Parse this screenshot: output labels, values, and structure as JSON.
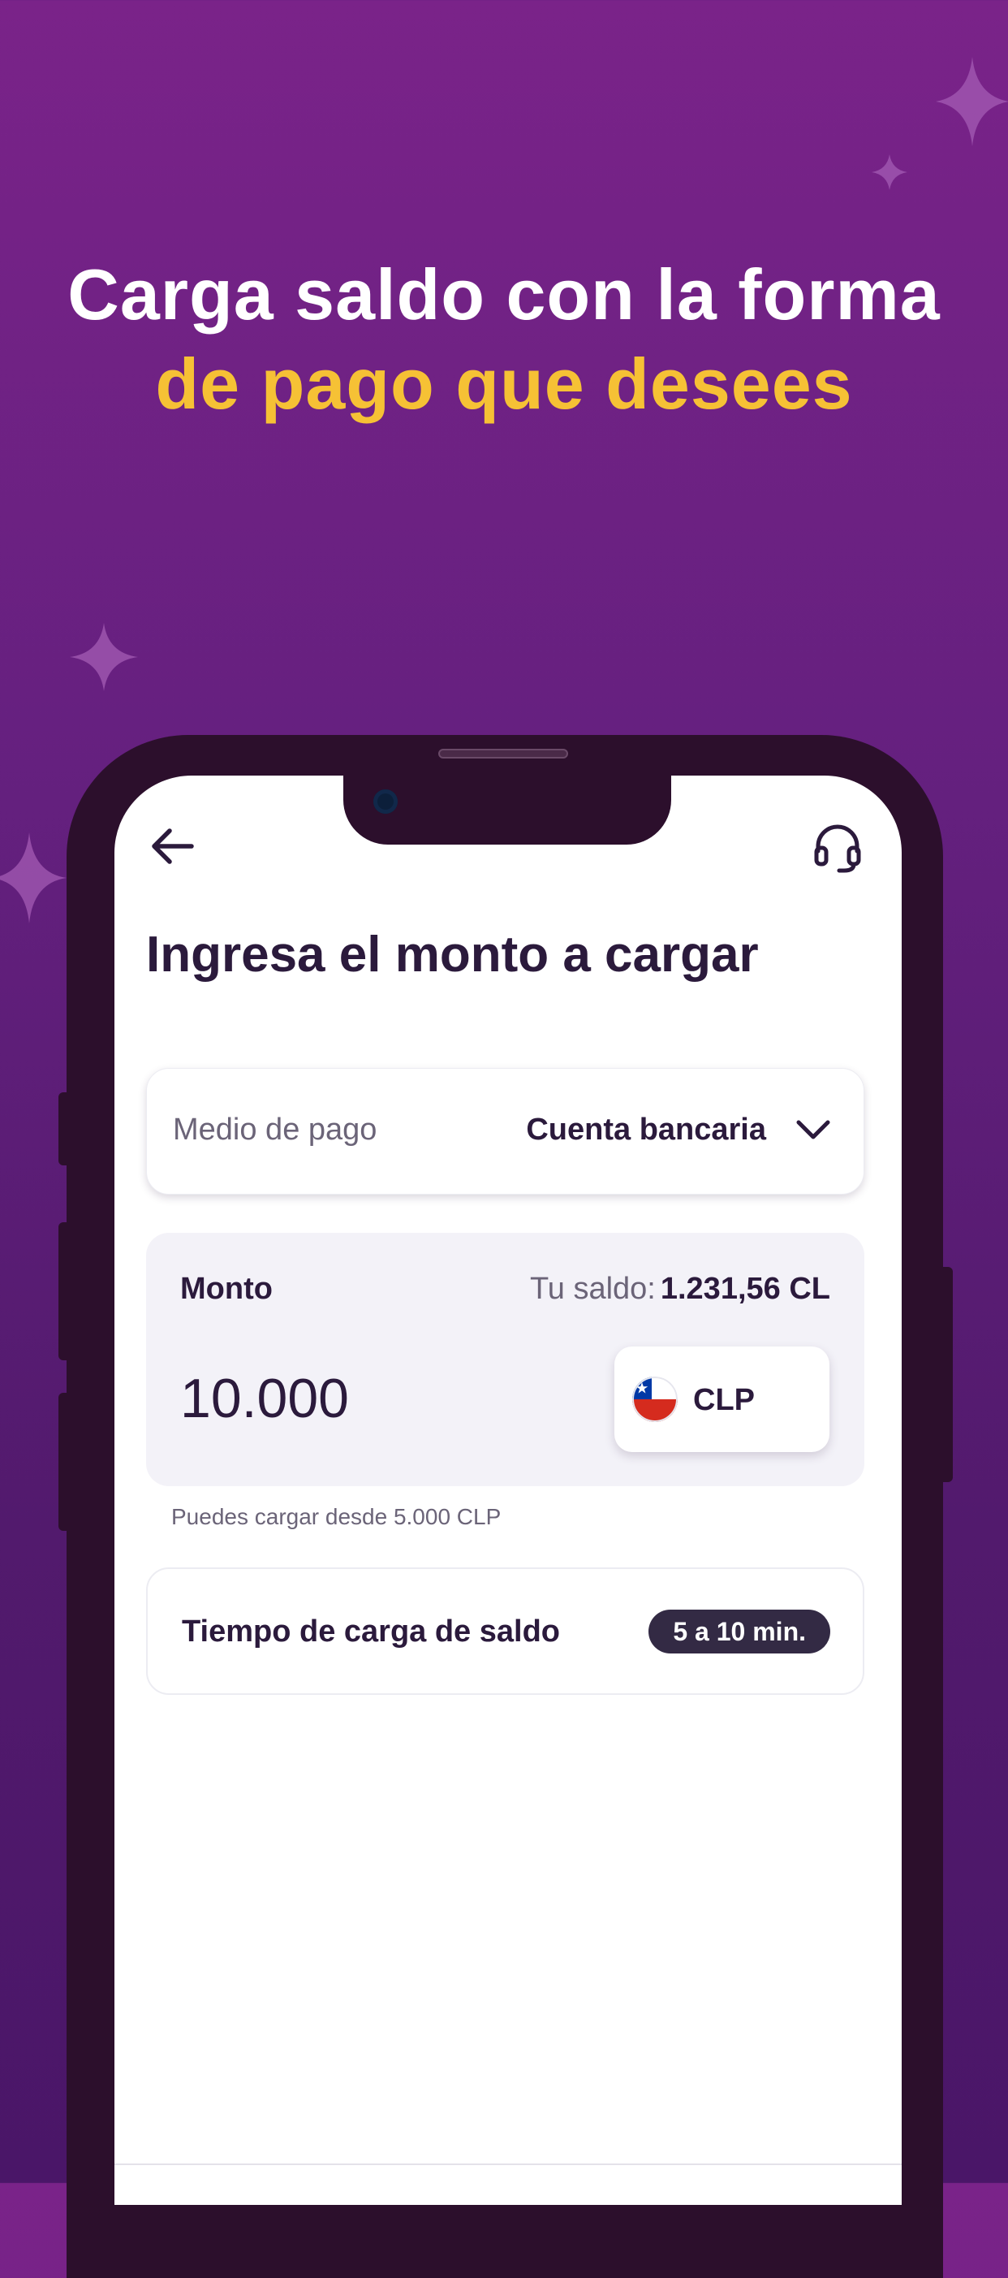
{
  "headline": {
    "line1": "Carga saldo con la forma",
    "line2": "de pago que desees"
  },
  "colors": {
    "background_top": "#7a2389",
    "background_bottom": "#4a1668",
    "headline_accent": "#f6c135",
    "text_dark": "#2b1a3c",
    "phone_frame": "#2c0f2c",
    "badge_bg": "#332a44"
  },
  "screen": {
    "icons": {
      "back": "arrow-left-icon",
      "support": "headset-icon"
    },
    "title": "Ingresa el monto a cargar",
    "payment_method": {
      "label": "Medio de pago",
      "value": "Cuenta bancaria",
      "icon": "chevron-down-icon"
    },
    "amount": {
      "label": "Monto",
      "balance_label": "Tu saldo:",
      "balance_value": "1.231,56 CL",
      "value": "10.000",
      "currency": "CLP",
      "currency_icon": "chile-flag-icon"
    },
    "hint": "Puedes cargar desde 5.000 CLP",
    "load_time": {
      "label": "Tiempo de carga de saldo",
      "badge": "5 a 10 min."
    }
  }
}
